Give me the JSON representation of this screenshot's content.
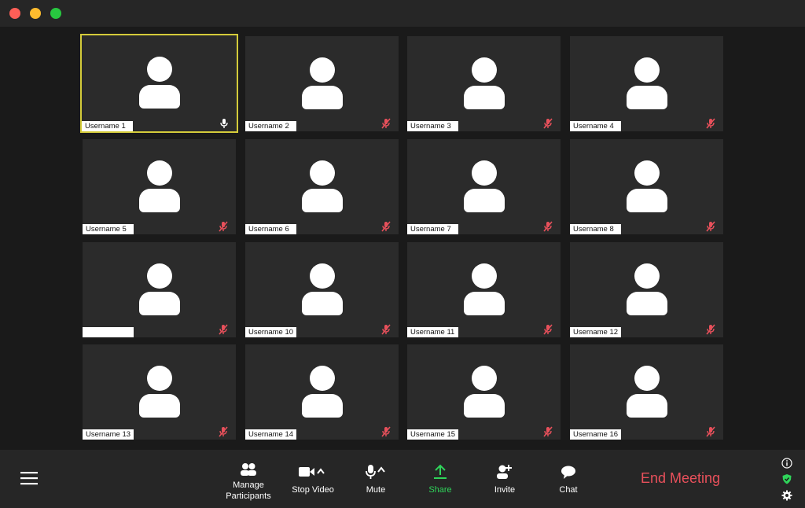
{
  "window": {
    "traffic_lights": [
      "#ff5f57",
      "#febc2e",
      "#28c840"
    ]
  },
  "participants": [
    {
      "name": "Username 1",
      "mic": "on",
      "active": true
    },
    {
      "name": "Username 2",
      "mic": "muted"
    },
    {
      "name": "Username 3",
      "mic": "muted"
    },
    {
      "name": "Username 4",
      "mic": "muted"
    },
    {
      "name": "Username 5",
      "mic": "muted"
    },
    {
      "name": "Username 6",
      "mic": "muted"
    },
    {
      "name": "Username 7",
      "mic": "muted"
    },
    {
      "name": "Username 8",
      "mic": "muted"
    },
    {
      "name": "",
      "mic": "muted"
    },
    {
      "name": "Username 10",
      "mic": "muted"
    },
    {
      "name": "Username 11",
      "mic": "muted"
    },
    {
      "name": "Username 12",
      "mic": "muted"
    },
    {
      "name": "Username 13",
      "mic": "muted"
    },
    {
      "name": "Username 14",
      "mic": "muted"
    },
    {
      "name": "Username 15",
      "mic": "muted"
    },
    {
      "name": "Username 16",
      "mic": "muted"
    }
  ],
  "toolbar": {
    "menu_icon": "hamburger-icon",
    "manage_participants_line1": "Manage",
    "manage_participants_line2": "Participants",
    "stop_video": "Stop Video",
    "mute": "Mute",
    "share": "Share",
    "invite": "Invite",
    "chat": "Chat",
    "end_meeting": "End Meeting"
  },
  "colors": {
    "active_speaker_border": "#d4cb3a",
    "muted_mic": "#e8505b",
    "share_green": "#2fd45a",
    "end_meeting": "#e8505b",
    "shield": "#2fd45a"
  }
}
